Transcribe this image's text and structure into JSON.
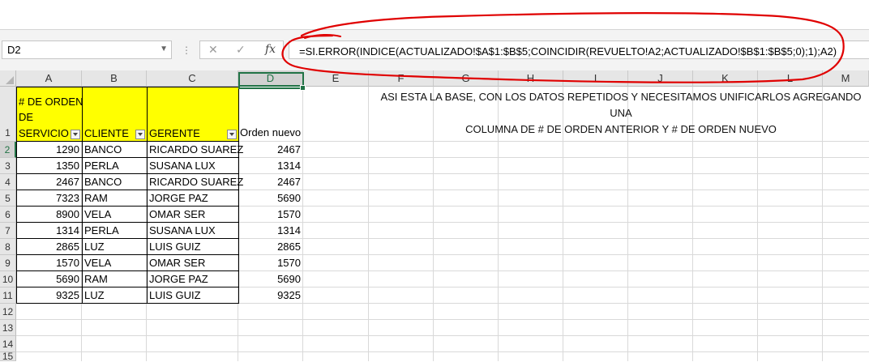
{
  "formula_bar": {
    "name_box": "D2",
    "cancel_icon": "cancel-x-icon",
    "enter_icon": "check-icon",
    "fx_label": "fx",
    "formula": "=SI.ERROR(INDICE(ACTUALIZADO!$A$1:$B$5;COINCIDIR(REVUELTO!A2;ACTUALIZADO!$B$1:$B$5;0);1);A2)"
  },
  "columns": [
    "A",
    "B",
    "C",
    "D",
    "E",
    "F",
    "G",
    "H",
    "I",
    "J",
    "K",
    "L",
    "M"
  ],
  "selected_column": "D",
  "rows": [
    "1",
    "2",
    "3",
    "4",
    "5",
    "6",
    "7",
    "8",
    "9",
    "10",
    "11",
    "12",
    "13",
    "14",
    "15"
  ],
  "selected_row": "2",
  "header": {
    "a_lines": [
      "# DE ORDEN",
      "DE",
      "SERVICIO"
    ],
    "b": "CLIENTE",
    "c": "GERENTE",
    "d": "Orden nuevo"
  },
  "table": [
    {
      "a": "1290",
      "b": "BANCO",
      "c": "RICARDO SUAREZ",
      "d": "2467"
    },
    {
      "a": "1350",
      "b": "PERLA",
      "c": "SUSANA LUX",
      "d": "1314"
    },
    {
      "a": "2467",
      "b": "BANCO",
      "c": "RICARDO SUAREZ",
      "d": "2467"
    },
    {
      "a": "7323",
      "b": "RAM",
      "c": "JORGE PAZ",
      "d": "5690"
    },
    {
      "a": "8900",
      "b": "VELA",
      "c": "OMAR SER",
      "d": "1570"
    },
    {
      "a": "1314",
      "b": "PERLA",
      "c": "SUSANA LUX",
      "d": "1314"
    },
    {
      "a": "2865",
      "b": "LUZ",
      "c": "LUIS GUIZ",
      "d": "2865"
    },
    {
      "a": "1570",
      "b": "VELA",
      "c": "OMAR SER",
      "d": "1570"
    },
    {
      "a": "5690",
      "b": "RAM",
      "c": "JORGE PAZ",
      "d": "5690"
    },
    {
      "a": "9325",
      "b": "LUZ",
      "c": "LUIS GUIZ",
      "d": "9325"
    }
  ],
  "note": {
    "line1": "ASI ESTA LA BASE, CON LOS DATOS REPETIDOS Y NECESITAMOS UNIFICARLOS AGREGANDO UNA",
    "line2": "COLUMNA DE # DE ORDEN ANTERIOR Y # DE ORDEN NUEVO"
  },
  "colors": {
    "header_fill": "#ffff00",
    "selection": "#217346",
    "annotation": "#e00000"
  }
}
